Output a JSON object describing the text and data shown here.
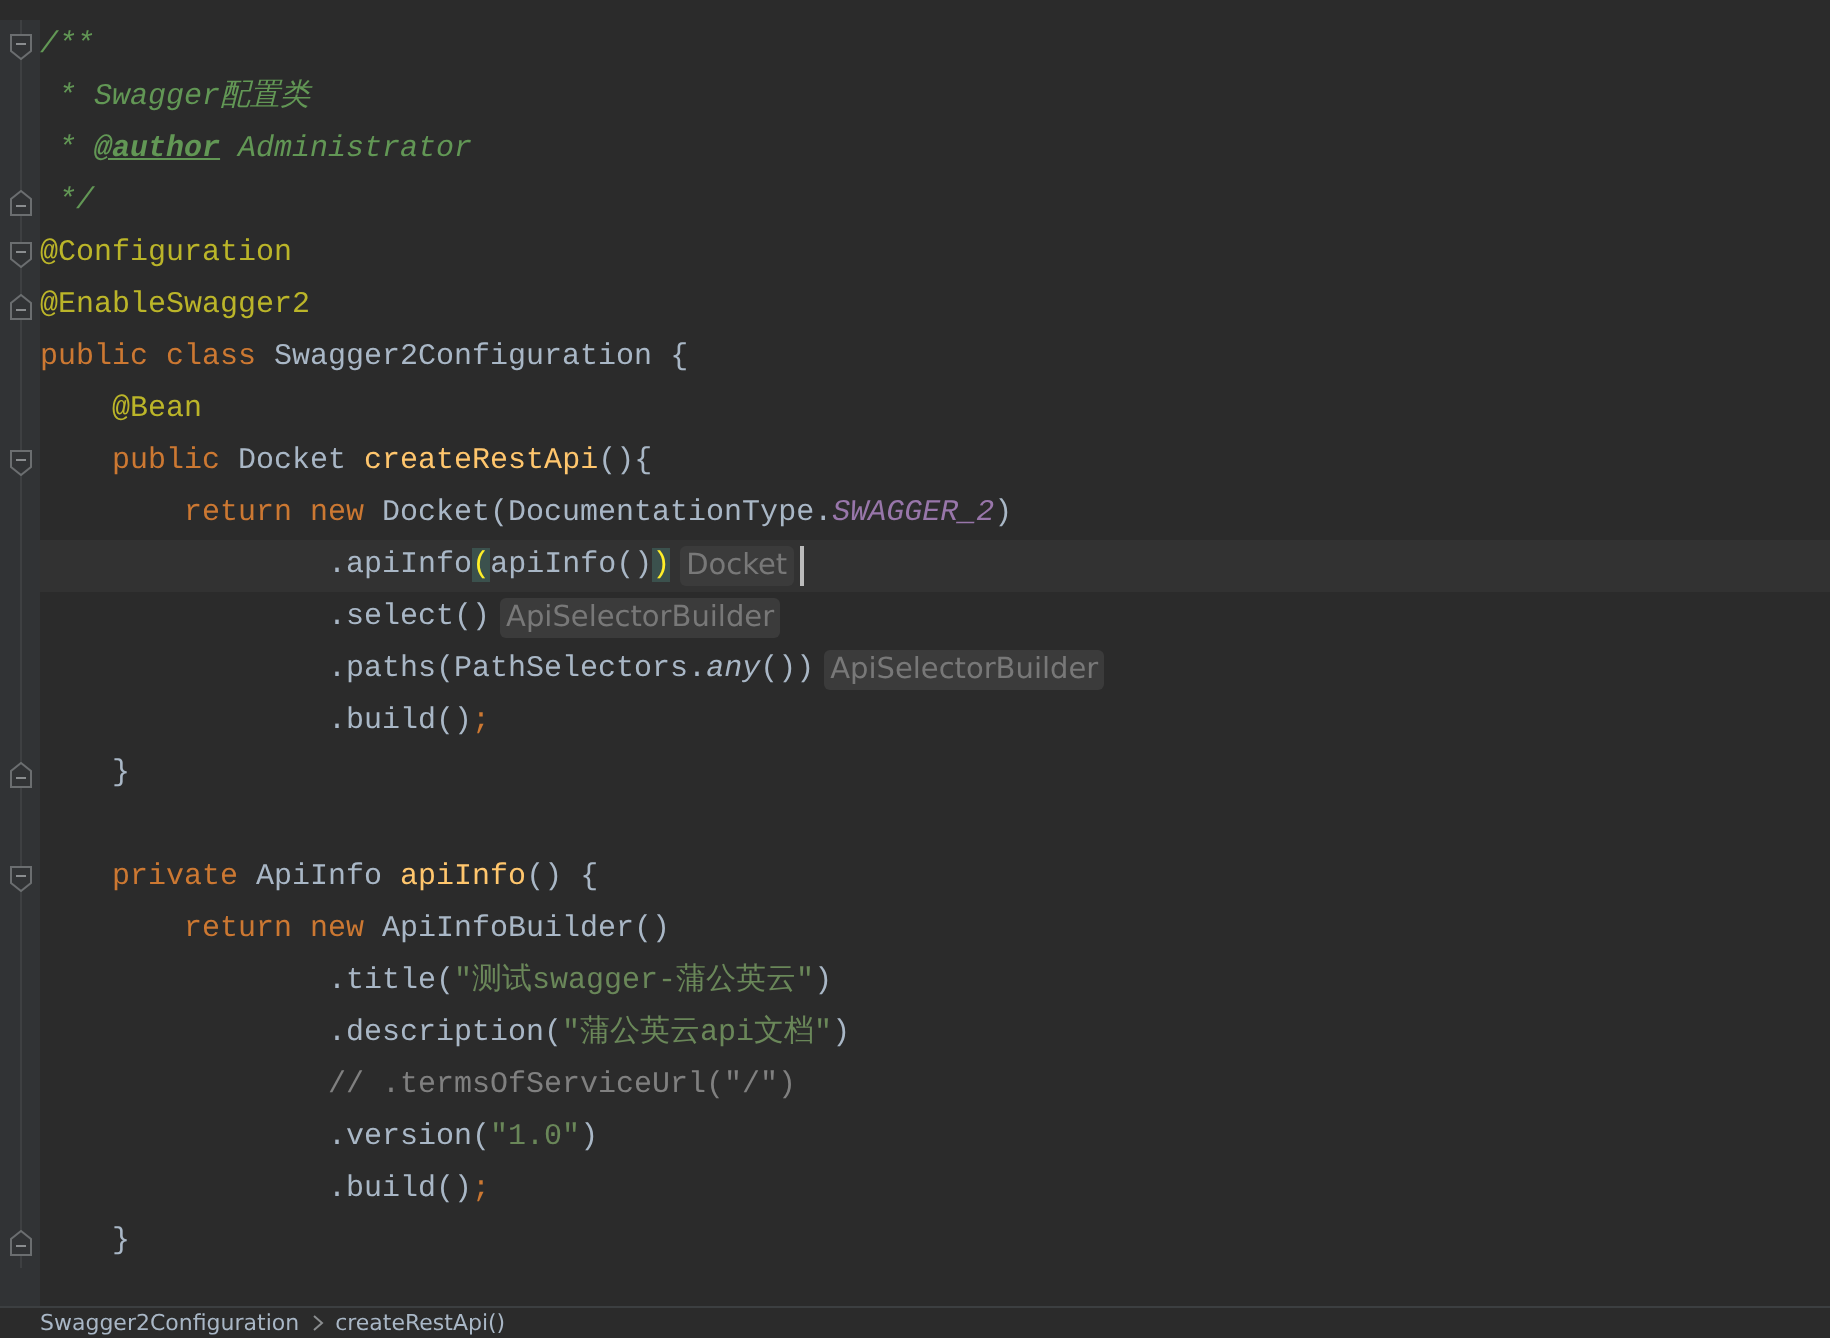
{
  "editor": {
    "lines": [
      {
        "current": false,
        "fold_start": true,
        "tokens": [
          {
            "kind": "doc",
            "text": "/**"
          }
        ]
      },
      {
        "current": false,
        "tokens": [
          {
            "kind": "doc",
            "text": " * Swagger配置类"
          }
        ]
      },
      {
        "current": false,
        "tokens": [
          {
            "kind": "doc",
            "text": " * "
          },
          {
            "kind": "doctag",
            "text": "@author"
          },
          {
            "kind": "doc",
            "text": " Administrator"
          }
        ]
      },
      {
        "current": false,
        "fold_end": true,
        "tokens": [
          {
            "kind": "doc",
            "text": " */"
          }
        ]
      },
      {
        "current": false,
        "fold_start": true,
        "tokens": [
          {
            "kind": "annotation",
            "text": "@Configuration"
          }
        ]
      },
      {
        "current": false,
        "fold_end": true,
        "tokens": [
          {
            "kind": "annotation",
            "text": "@EnableSwagger2"
          }
        ]
      },
      {
        "current": false,
        "tokens": [
          {
            "kind": "keyword",
            "text": "public class "
          },
          {
            "kind": "plain",
            "text": "Swagger2Configuration {"
          }
        ]
      },
      {
        "current": false,
        "tokens": [
          {
            "kind": "annotation",
            "text": "    @Bean"
          }
        ]
      },
      {
        "current": false,
        "fold_start": true,
        "tokens": [
          {
            "kind": "keyword",
            "text": "    public "
          },
          {
            "kind": "plain",
            "text": "Docket "
          },
          {
            "kind": "method",
            "text": "createRestApi"
          },
          {
            "kind": "plain",
            "text": "(){"
          }
        ]
      },
      {
        "current": false,
        "tokens": [
          {
            "kind": "keyword",
            "text": "        return new "
          },
          {
            "kind": "plain",
            "text": "Docket(DocumentationType."
          },
          {
            "kind": "constant",
            "text": "SWAGGER_2"
          },
          {
            "kind": "plain",
            "text": ")"
          }
        ]
      },
      {
        "current": true,
        "hint": "Docket",
        "tokens": [
          {
            "kind": "plain",
            "text": "                .apiInfo"
          },
          {
            "kind": "match",
            "text": "("
          },
          {
            "kind": "plain",
            "text": "apiInfo()"
          },
          {
            "kind": "match",
            "text": ")"
          }
        ]
      },
      {
        "current": false,
        "hint": "ApiSelectorBuilder",
        "tokens": [
          {
            "kind": "plain",
            "text": "                .select()"
          }
        ]
      },
      {
        "current": false,
        "hint": "ApiSelectorBuilder",
        "tokens": [
          {
            "kind": "plain",
            "text": "                .paths(PathSelectors."
          },
          {
            "kind": "static",
            "text": "any"
          },
          {
            "kind": "plain",
            "text": "())"
          }
        ]
      },
      {
        "current": false,
        "tokens": [
          {
            "kind": "plain",
            "text": "                .build()"
          },
          {
            "kind": "keyword",
            "text": ";"
          }
        ]
      },
      {
        "current": false,
        "fold_end": true,
        "tokens": [
          {
            "kind": "plain",
            "text": "    }"
          }
        ]
      },
      {
        "current": false
      },
      {
        "current": false,
        "fold_start": true,
        "tokens": [
          {
            "kind": "keyword",
            "text": "    private "
          },
          {
            "kind": "plain",
            "text": "ApiInfo "
          },
          {
            "kind": "method",
            "text": "apiInfo"
          },
          {
            "kind": "plain",
            "text": "() {"
          }
        ]
      },
      {
        "current": false,
        "tokens": [
          {
            "kind": "keyword",
            "text": "        return new "
          },
          {
            "kind": "plain",
            "text": "ApiInfoBuilder()"
          }
        ]
      },
      {
        "current": false,
        "tokens": [
          {
            "kind": "plain",
            "text": "                .title("
          },
          {
            "kind": "string",
            "text": "\"测试swagger-蒲公英云\""
          },
          {
            "kind": "plain",
            "text": ")"
          }
        ]
      },
      {
        "current": false,
        "tokens": [
          {
            "kind": "plain",
            "text": "                .description("
          },
          {
            "kind": "string",
            "text": "\"蒲公英云api文档\""
          },
          {
            "kind": "plain",
            "text": ")"
          }
        ]
      },
      {
        "current": false,
        "tokens": [
          {
            "kind": "comment",
            "text": "                // .termsOfServiceUrl(\"/\")"
          }
        ]
      },
      {
        "current": false,
        "tokens": [
          {
            "kind": "plain",
            "text": "                .version("
          },
          {
            "kind": "string",
            "text": "\"1.0\""
          },
          {
            "kind": "plain",
            "text": ")"
          }
        ]
      },
      {
        "current": false,
        "tokens": [
          {
            "kind": "plain",
            "text": "                .build()"
          },
          {
            "kind": "keyword",
            "text": ";"
          }
        ]
      },
      {
        "current": false,
        "fold_end": true,
        "tokens": [
          {
            "kind": "plain",
            "text": "    }"
          }
        ]
      }
    ]
  },
  "breadcrumbs": [
    "Swagger2Configuration",
    "createRestApi()"
  ]
}
